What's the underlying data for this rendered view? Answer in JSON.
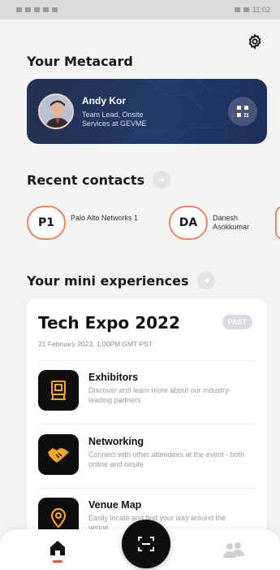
{
  "status_bar": {
    "time": "11:02"
  },
  "metacard": {
    "section_title": "Your Metacard",
    "name": "Andy Kor",
    "role": "Team Lead, Onsite Services at GEVME"
  },
  "recent_contacts": {
    "section_title": "Recent contacts",
    "items": [
      {
        "initials": "P1",
        "name": "Palo Alto Networks 1"
      },
      {
        "initials": "DA",
        "name": "Danesh Asokkumar"
      }
    ]
  },
  "mini_experiences": {
    "section_title": "Your mini experiences",
    "event": {
      "title": "Tech Expo 2022",
      "badge": "PAST",
      "date": "21 February 2023, 1:00PM GMT PST"
    },
    "features": [
      {
        "title": "Exhibitors",
        "description": "Discover and learn more about our industry-leading partners",
        "icon": "exhibitor-booth-icon"
      },
      {
        "title": "Networking",
        "description": "Connect with other attendees at the event - both online and onsite",
        "icon": "handshake-icon"
      },
      {
        "title": "Venue Map",
        "description": "Easily locate and find your way around the venue",
        "icon": "map-pin-icon"
      }
    ]
  },
  "nav": {
    "home": "home-icon",
    "scan": "scan-icon",
    "people": "people-icon"
  },
  "colors": {
    "accent": "#e8543a",
    "card_bg": "#243b6b",
    "icon_gold": "#f5a623"
  }
}
